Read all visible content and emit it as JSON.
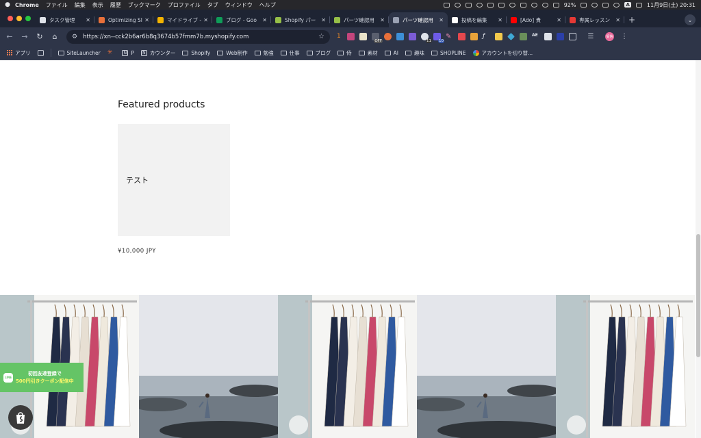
{
  "menubar": {
    "app_name": "Chrome",
    "items": [
      "ファイル",
      "編集",
      "表示",
      "履歴",
      "ブックマーク",
      "プロファイル",
      "タブ",
      "ウィンドウ",
      "ヘルプ"
    ],
    "battery": "92%",
    "input_mode": "A",
    "clock": "11月9日(土) 20:31"
  },
  "tabs": [
    {
      "label": "タスク管理",
      "favicon_color": "#dfe3ea"
    },
    {
      "label": "Optimizing Sl",
      "favicon_color": "#e8703a"
    },
    {
      "label": "マイドライブ -",
      "favicon_color": "#f4b400"
    },
    {
      "label": "ブログ - Goo",
      "favicon_color": "#0f9d58"
    },
    {
      "label": "Shopify パー",
      "favicon_color": "#96bf48"
    },
    {
      "label": "パーツ確認用",
      "favicon_color": "#96bf48"
    },
    {
      "label": "パーツ確認用",
      "favicon_color": "#9aa1b3",
      "active": true
    },
    {
      "label": "投稿を編集",
      "favicon_color": "#ffffff"
    },
    {
      "label": "[Ado] 貴",
      "favicon_color": "#ff0000"
    },
    {
      "label": "専属レッスン",
      "favicon_color": "#e53935"
    }
  ],
  "toolbar": {
    "url": "https://xn--cck2b6ar6b8q3674b57fmm7b.myshopify.com",
    "badge_off": "OFF",
    "badge_11": "11",
    "badge_10": "10",
    "profile_label": "受信"
  },
  "bookmarks": [
    {
      "label": "アプリ",
      "type": "apps"
    },
    {
      "label": "SiteLauncher",
      "type": "folder"
    },
    {
      "label": "",
      "type": "sparkle"
    },
    {
      "label": "P",
      "type": "notion"
    },
    {
      "label": "カウンター",
      "type": "notion"
    },
    {
      "label": "Shopify",
      "type": "folder"
    },
    {
      "label": "Web制作",
      "type": "folder"
    },
    {
      "label": "勉強",
      "type": "folder"
    },
    {
      "label": "仕事",
      "type": "folder"
    },
    {
      "label": "ブログ",
      "type": "folder"
    },
    {
      "label": "侍",
      "type": "folder"
    },
    {
      "label": "素材",
      "type": "folder"
    },
    {
      "label": "AI",
      "type": "folder"
    },
    {
      "label": "趣味",
      "type": "folder"
    },
    {
      "label": "SHOPLINE",
      "type": "folder"
    },
    {
      "label": "アカウントを切り替...",
      "type": "google"
    }
  ],
  "page": {
    "featured_title": "Featured products",
    "product": {
      "name": "テスト",
      "price": "¥10,000 JPY"
    },
    "gallery_tiles": [
      "clothes",
      "sea",
      "clothes",
      "sea",
      "clothes"
    ],
    "line_banner": {
      "line1": "初回友達登録で",
      "line2": "500円引きクーポン配信中",
      "icon_label": "LINE"
    }
  }
}
